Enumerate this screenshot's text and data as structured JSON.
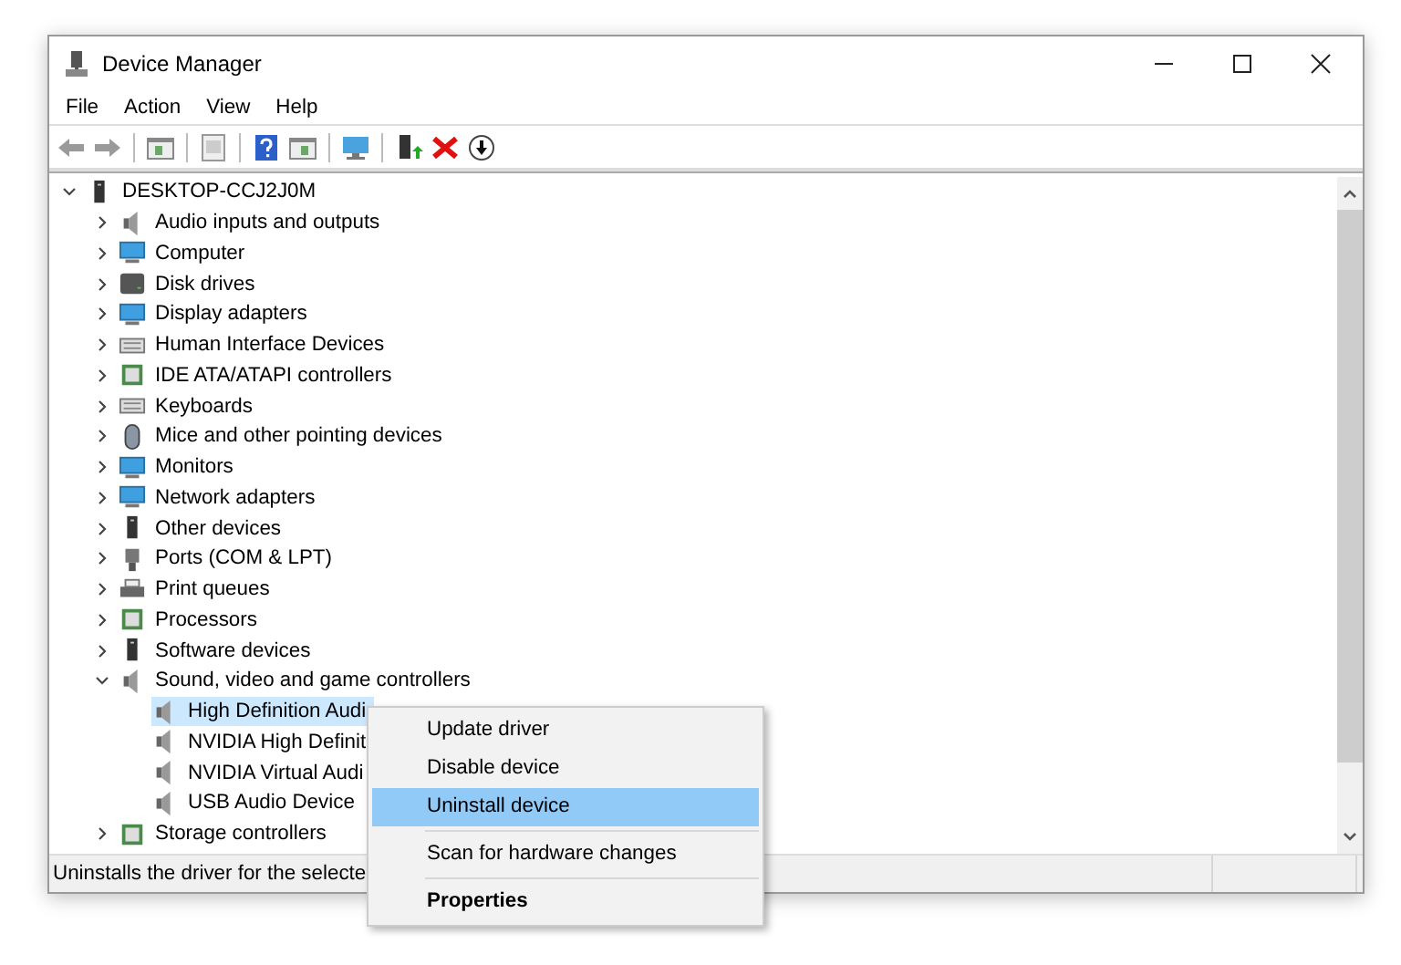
{
  "window": {
    "title": "Device Manager"
  },
  "menu_bar": [
    "File",
    "Action",
    "View",
    "Help"
  ],
  "tree": {
    "label": "DESKTOP-CCJ2J0M",
    "expanded": true,
    "selected": false,
    "children": [
      {
        "label": "Audio inputs and outputs",
        "expanded": false,
        "selected": false
      },
      {
        "label": "Computer",
        "expanded": false,
        "selected": false
      },
      {
        "label": "Disk drives",
        "expanded": false,
        "selected": false
      },
      {
        "label": "Display adapters",
        "expanded": false,
        "selected": false
      },
      {
        "label": "Human Interface Devices",
        "expanded": false,
        "selected": false
      },
      {
        "label": "IDE ATA/ATAPI controllers",
        "expanded": false,
        "selected": false
      },
      {
        "label": "Keyboards",
        "expanded": false,
        "selected": false
      },
      {
        "label": "Mice and other pointing devices",
        "expanded": false,
        "selected": false
      },
      {
        "label": "Monitors",
        "expanded": false,
        "selected": false
      },
      {
        "label": "Network adapters",
        "expanded": false,
        "selected": false
      },
      {
        "label": "Other devices",
        "expanded": false,
        "selected": false
      },
      {
        "label": "Ports (COM & LPT)",
        "expanded": false,
        "selected": false
      },
      {
        "label": "Print queues",
        "expanded": false,
        "selected": false
      },
      {
        "label": "Processors",
        "expanded": false,
        "selected": false
      },
      {
        "label": "Software devices",
        "expanded": false,
        "selected": false
      },
      {
        "label": "Sound, video and game controllers",
        "expanded": true,
        "selected": false,
        "children": [
          {
            "label": "High Definition Audi",
            "selected": true
          },
          {
            "label": "NVIDIA High Definit",
            "selected": false
          },
          {
            "label": "NVIDIA Virtual Audi",
            "selected": false
          },
          {
            "label": "USB Audio Device",
            "selected": false
          }
        ]
      },
      {
        "label": "Storage controllers",
        "expanded": false,
        "selected": false
      }
    ]
  },
  "status_bar": "Uninstalls the driver for the selecte",
  "context_menu": [
    {
      "kind": "item",
      "label": "Update driver",
      "selected": false,
      "bold": false
    },
    {
      "kind": "item",
      "label": "Disable device",
      "selected": false,
      "bold": false
    },
    {
      "kind": "item",
      "label": "Uninstall device",
      "selected": true,
      "bold": false
    },
    {
      "kind": "separator"
    },
    {
      "kind": "item",
      "label": "Scan for hardware changes",
      "selected": false,
      "bold": false
    },
    {
      "kind": "separator"
    },
    {
      "kind": "item",
      "label": "Properties",
      "selected": false,
      "bold": true
    }
  ]
}
